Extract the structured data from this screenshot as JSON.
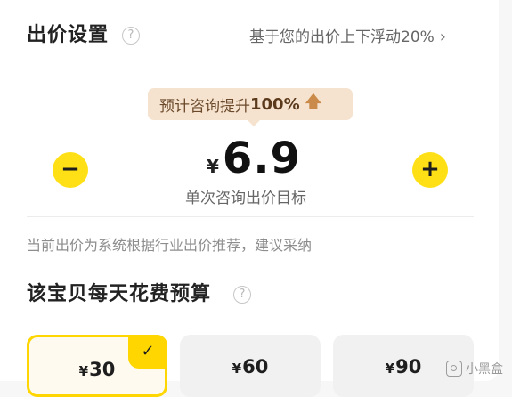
{
  "bid_settings": {
    "title": "出价设置",
    "help_icon": "question-circle-icon",
    "float_link": "基于您的出价上下浮动20%",
    "float_link_chevron": "›",
    "forecast": {
      "prefix": "预计咨询提升",
      "percent": "100%",
      "arrow": "🡅"
    },
    "decrease_symbol": "−",
    "increase_symbol": "+",
    "currency": "¥",
    "price": "6.9",
    "price_caption": "单次咨询出价目标",
    "hint": "当前出价为系统根据行业出价推荐，建议采纳"
  },
  "budget": {
    "title": "该宝贝每天花费预算",
    "help_icon": "question-circle-icon",
    "options": [
      {
        "currency": "¥",
        "amount": "30",
        "selected": true,
        "check": "✓"
      },
      {
        "currency": "¥",
        "amount": "60",
        "selected": false
      },
      {
        "currency": "¥",
        "amount": "90",
        "selected": false
      }
    ]
  },
  "watermark": {
    "text": "小黑盒"
  },
  "colors": {
    "accent_yellow": "#ffe016",
    "forecast_bubble": "#f6e3cf",
    "selected_border": "#ffd600"
  }
}
